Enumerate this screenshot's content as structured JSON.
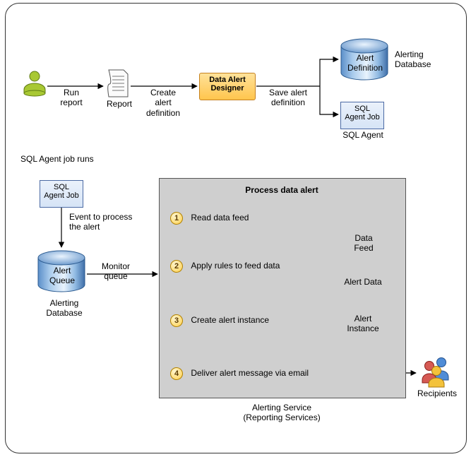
{
  "top": {
    "run_report": "Run\nreport",
    "report_label": "Report",
    "create_def": "Create\nalert\ndefinition",
    "designer": "Data Alert\nDesigner",
    "save_def": "Save alert\ndefinition",
    "alert_definition": "Alert\nDefinition",
    "alerting_db": "Alerting\nDatabase",
    "sql_agent_job": "SQL\nAgent Job",
    "sql_agent": "SQL Agent"
  },
  "mid": {
    "job_runs": "SQL Agent job runs",
    "sql_agent_job": "SQL\nAgent Job",
    "event_text": "Event to process\nthe alert",
    "alert_queue": "Alert\nQueue",
    "alerting_db": "Alerting\nDatabase",
    "monitor_queue": "Monitor\nqueue"
  },
  "process": {
    "title": "Process data alert",
    "steps": [
      {
        "num": "1",
        "text": "Read data feed"
      },
      {
        "num": "2",
        "text": "Apply rules to feed data"
      },
      {
        "num": "3",
        "text": "Create alert instance"
      },
      {
        "num": "4",
        "text": "Deliver alert message via email"
      }
    ],
    "data_feed": "Data Feed",
    "alert_data": "Alert Data",
    "alert_instance": "Alert\nInstance",
    "recipients": "Recipients",
    "caption": "Alerting Service\n(Reporting Services)"
  }
}
